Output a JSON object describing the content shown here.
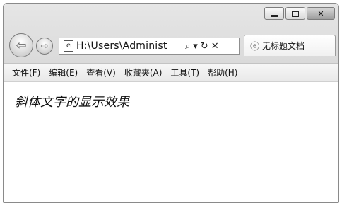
{
  "window": {
    "controls": [
      "minimize",
      "maximize",
      "close"
    ],
    "close_symbol": "✕"
  },
  "nav": {
    "back_icon": "arrow-left-icon",
    "forward_icon": "arrow-right-icon",
    "address": "H:\\Users\\Administ",
    "address_icons": [
      "search-icon",
      "dropdown-icon",
      "refresh-icon",
      "stop-icon"
    ],
    "tab_title": "无标题文档"
  },
  "menu": {
    "items": [
      "文件(F)",
      "编辑(E)",
      "查看(V)",
      "收藏夹(A)",
      "工具(T)",
      "帮助(H)"
    ]
  },
  "page": {
    "content_text": "斜体文字的显示效果"
  }
}
